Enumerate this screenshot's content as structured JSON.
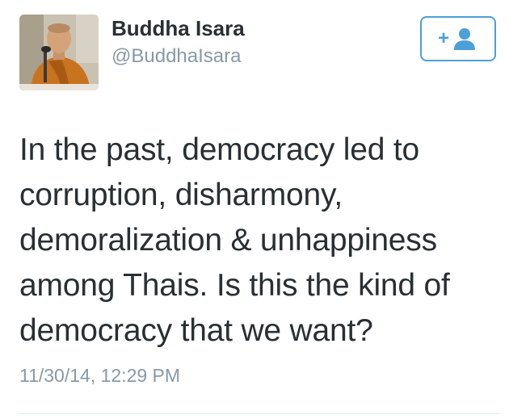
{
  "user": {
    "display_name": "Buddha Isara",
    "screen_name": "@BuddhaIsara",
    "avatar_icon": "profile-photo"
  },
  "follow_button": {
    "icon": "add-user-icon",
    "plus_glyph": "+",
    "color": "#4ba0d8"
  },
  "tweet": {
    "lines": [
      "In the past, democracy led to",
      "corruption, disharmony,",
      "demoralization & unhappiness",
      "among Thais. Is this the kind of",
      "democracy that we want?"
    ],
    "timestamp": "11/30/14, 12:29 PM"
  },
  "colors": {
    "text": "#292f33",
    "secondary": "#8899a6",
    "accent": "#4ba0d8",
    "divider": "#e1e8ed"
  }
}
